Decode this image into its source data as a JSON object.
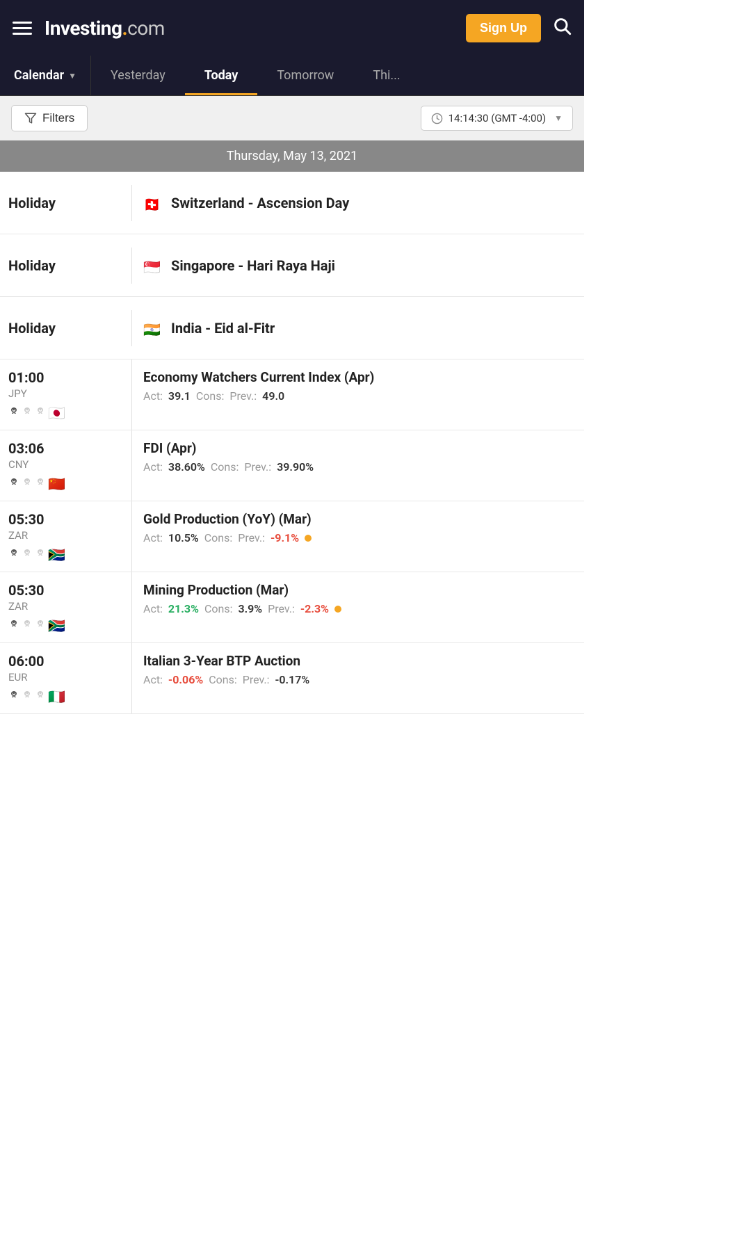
{
  "header": {
    "logo_invest": "Investing",
    "logo_dot": ".",
    "logo_com": "com",
    "signup_label": "Sign Up",
    "hamburger_label": "menu"
  },
  "nav": {
    "calendar_label": "Calendar",
    "tabs": [
      {
        "id": "yesterday",
        "label": "Yesterday",
        "active": false
      },
      {
        "id": "today",
        "label": "Today",
        "active": true
      },
      {
        "id": "tomorrow",
        "label": "Tomorrow",
        "active": false
      },
      {
        "id": "this-week",
        "label": "This...",
        "active": false
      }
    ]
  },
  "toolbar": {
    "filters_label": "Filters",
    "time_display": "14:14:30 (GMT -4:00)"
  },
  "date_separator": "Thursday, May 13, 2021",
  "events": [
    {
      "type": "holiday",
      "label": "Holiday",
      "flag": "🇨🇭",
      "name": "Switzerland - Ascension Day"
    },
    {
      "type": "holiday",
      "label": "Holiday",
      "flag": "🇸🇬",
      "name": "Singapore - Hari Raya Haji"
    },
    {
      "type": "holiday",
      "label": "Holiday",
      "flag": "🇮🇳",
      "name": "India - Eid al-Fitr"
    },
    {
      "type": "event",
      "time": "01:00",
      "currency": "JPY",
      "flag": "🇯🇵",
      "impact": [
        true,
        false,
        false
      ],
      "name": "Economy Watchers Current Index (Apr)",
      "act": "39.1",
      "act_color": "normal",
      "cons": "",
      "prev": "49.0",
      "prev_color": "normal",
      "show_dot": false
    },
    {
      "type": "event",
      "time": "03:06",
      "currency": "CNY",
      "flag": "🇨🇳",
      "impact": [
        true,
        false,
        false
      ],
      "name": "FDI (Apr)",
      "act": "38.60%",
      "act_color": "normal",
      "cons": "",
      "prev": "39.90%",
      "prev_color": "normal",
      "show_dot": false
    },
    {
      "type": "event",
      "time": "05:30",
      "currency": "ZAR",
      "flag": "🇿🇦",
      "impact": [
        true,
        false,
        false
      ],
      "name": "Gold Production (YoY) (Mar)",
      "act": "10.5%",
      "act_color": "normal",
      "cons": "",
      "prev": "-9.1%",
      "prev_color": "red",
      "show_dot": true
    },
    {
      "type": "event",
      "time": "05:30",
      "currency": "ZAR",
      "flag": "🇿🇦",
      "impact": [
        true,
        false,
        false
      ],
      "name": "Mining Production (Mar)",
      "act": "21.3%",
      "act_color": "green",
      "cons": "3.9%",
      "cons_color": "normal",
      "prev": "-2.3%",
      "prev_color": "red",
      "show_dot": true
    },
    {
      "type": "event",
      "time": "06:00",
      "currency": "EUR",
      "flag": "🇮🇹",
      "impact": [
        true,
        false,
        false
      ],
      "name": "Italian 3-Year BTP Auction",
      "act": "-0.06%",
      "act_color": "red",
      "cons": "",
      "prev": "-0.17%",
      "prev_color": "normal",
      "show_dot": false
    }
  ]
}
